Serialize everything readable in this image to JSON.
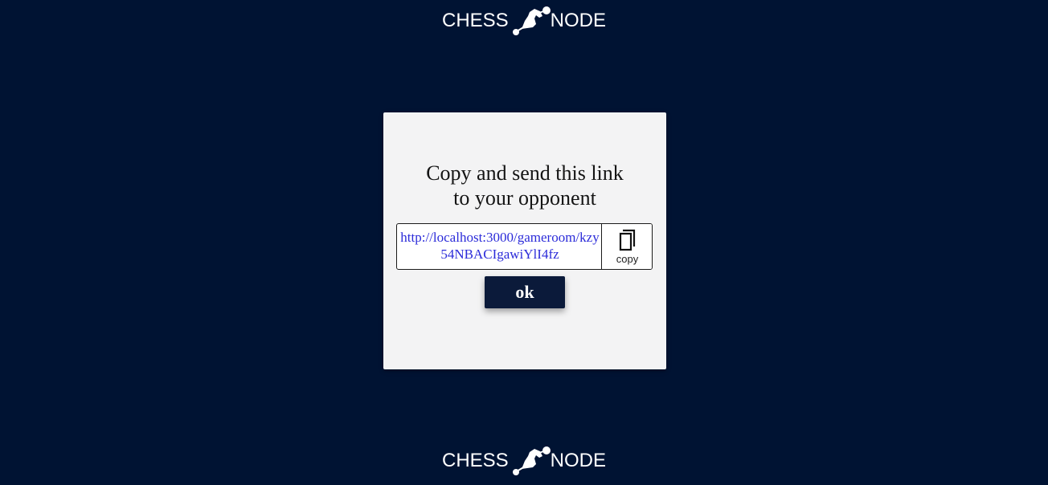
{
  "header": {
    "logo_left": "CHESS",
    "logo_right": "NODE",
    "logo_icon": "knight-node-icon"
  },
  "modal": {
    "title_line1": "Copy and send this link",
    "title_line2": "to your opponent",
    "link": "http://localhost:3000/gameroom/kzy54NBACIgawiYlI4fz",
    "copy_icon": "copy-icon",
    "copy_label": "copy",
    "ok_label": "ok"
  },
  "footer": {
    "logo_left": "CHESS",
    "logo_right": "NODE",
    "logo_icon": "knight-node-icon"
  },
  "colors": {
    "background": "#001333",
    "modal_bg": "#f3f3f4",
    "link": "#2b2bd9",
    "button_bg": "#0b1a3a"
  }
}
